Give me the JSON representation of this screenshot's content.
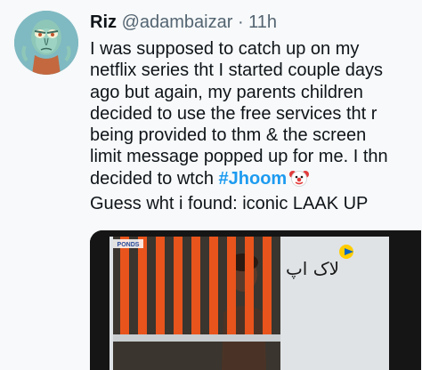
{
  "tweet": {
    "display_name": "Riz",
    "handle": "@adambaizar",
    "separator": "·",
    "time": "11h",
    "lines": [
      "I was supposed to catch up on my",
      "netflix series tht I started couple days",
      "ago but again, my parents children",
      "decided to use the free services tht r",
      "being provided to thm & the screen",
      "limit message popped up for me. I thn"
    ],
    "line7_prefix": "decided to wtch ",
    "hashtag": "#Jhoom",
    "emoji_icon": "clown-face-icon",
    "line8": "Guess wht i found: iconic LAAK UP"
  },
  "media": {
    "watermark": "PONDS",
    "urdu_caption": "لاک اپ",
    "channel_logo": "geo-logo-icon",
    "bar_color": "#e8541c",
    "wall_color": "#dfe3e6"
  },
  "colors": {
    "background": "#f7f9fa",
    "text": "#0f1419",
    "muted": "#536471",
    "link": "#1d9bf0"
  }
}
